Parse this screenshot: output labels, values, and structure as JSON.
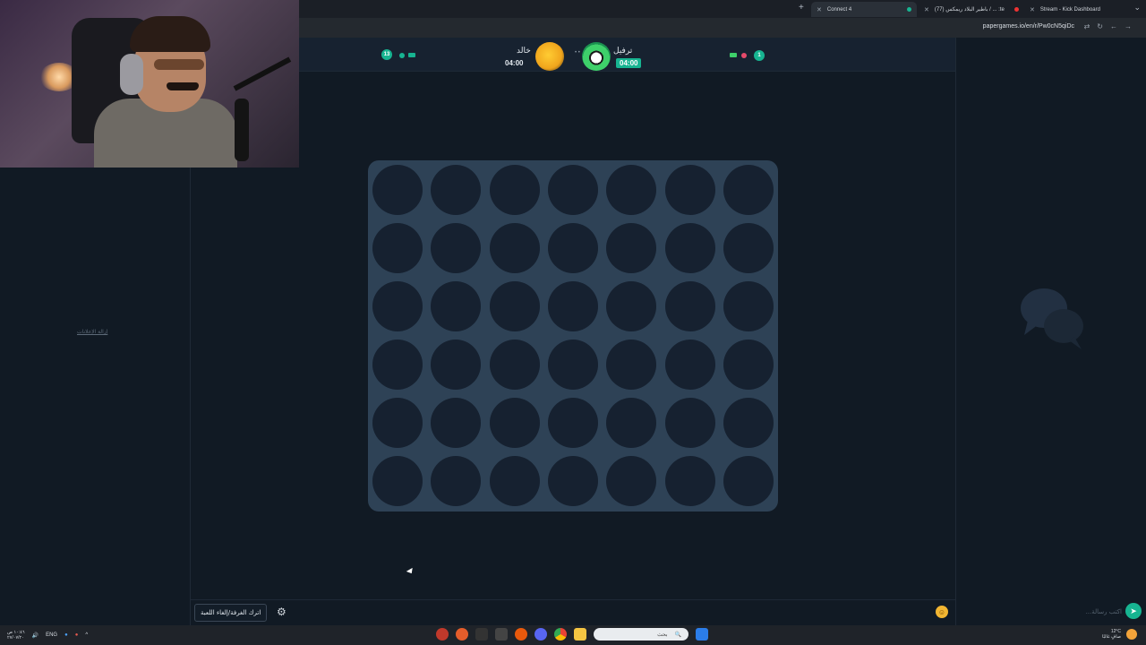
{
  "browser": {
    "tabs": [
      {
        "label": "Connect 4",
        "active": true
      },
      {
        "label": "(77) باطير البلاد ريمكس / ... :te",
        "active": false
      },
      {
        "label": "Stream - Kick Dashboard",
        "active": false
      }
    ],
    "url": "papergames.io/en/r/Pw0cN5qiDc"
  },
  "game": {
    "title": "Connect 4",
    "rows": 6,
    "cols": 7,
    "left_panel": {
      "remove_ads_link": "إزالة الإعلانات"
    },
    "player_left": {
      "name": "خالد",
      "time": "04:00",
      "badge": "13"
    },
    "player_right": {
      "name": "ترفيل",
      "time": "04:00",
      "badge": "1"
    },
    "colors": {
      "accent": "#17b491",
      "board": "#2e4256",
      "hole": "#162130",
      "background": "#111a24"
    }
  },
  "bottom": {
    "leave_button": "اترك الغرفة/إلغاء اللعبة",
    "chat_placeholder": "اكتب رسالة..."
  },
  "taskbar": {
    "lang": "ENG",
    "search_placeholder": "بحث",
    "time": "١٠:٤٦ ص",
    "date": "٢٧/٠٧/٢٠",
    "weather_temp": "12°C",
    "weather_desc": "صافٍ غالبًا"
  }
}
